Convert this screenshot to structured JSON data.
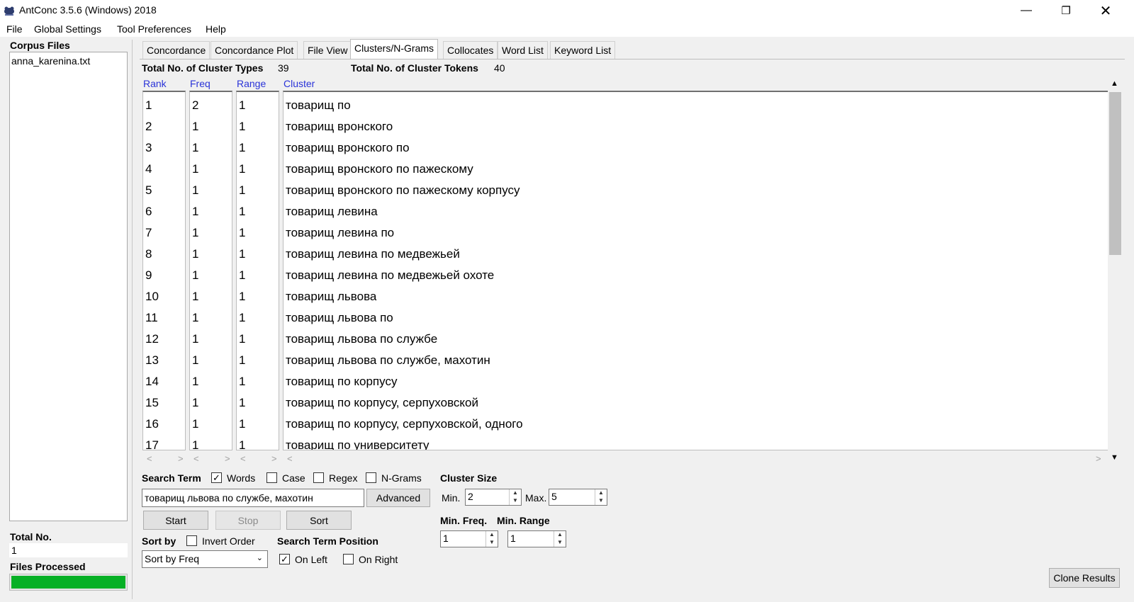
{
  "window": {
    "title": "AntConc 3.5.6 (Windows) 2018"
  },
  "menu": [
    "File",
    "Global Settings",
    "Tool Preferences",
    "Help"
  ],
  "left_panel": {
    "corpus_files_label": "Corpus Files",
    "files": [
      "anna_karenina.txt"
    ],
    "total_no_label": "Total No.",
    "total_no_value": "1",
    "files_processed_label": "Files Processed",
    "progress": 1.0
  },
  "tabs": [
    "Concordance",
    "Concordance Plot",
    "File View",
    "Clusters/N-Grams",
    "Collocates",
    "Word List",
    "Keyword List"
  ],
  "active_tab": "Clusters/N-Grams",
  "stats": {
    "types_label": "Total No. of Cluster Types",
    "types_value": "39",
    "tokens_label": "Total No. of Cluster Tokens",
    "tokens_value": "40"
  },
  "columns": {
    "rank": "Rank",
    "freq": "Freq",
    "range": "Range",
    "cluster": "Cluster"
  },
  "rows": [
    {
      "rank": "1",
      "freq": "2",
      "range": "1",
      "cluster": "товарищ по"
    },
    {
      "rank": "2",
      "freq": "1",
      "range": "1",
      "cluster": "товарищ вронского"
    },
    {
      "rank": "3",
      "freq": "1",
      "range": "1",
      "cluster": "товарищ вронского по"
    },
    {
      "rank": "4",
      "freq": "1",
      "range": "1",
      "cluster": "товарищ вронского по пажескому"
    },
    {
      "rank": "5",
      "freq": "1",
      "range": "1",
      "cluster": "товарищ вронского по пажескому корпусу"
    },
    {
      "rank": "6",
      "freq": "1",
      "range": "1",
      "cluster": "товарищ левина"
    },
    {
      "rank": "7",
      "freq": "1",
      "range": "1",
      "cluster": "товарищ левина по"
    },
    {
      "rank": "8",
      "freq": "1",
      "range": "1",
      "cluster": "товарищ левина по медвежьей"
    },
    {
      "rank": "9",
      "freq": "1",
      "range": "1",
      "cluster": "товарищ левина по медвежьей охоте"
    },
    {
      "rank": "10",
      "freq": "1",
      "range": "1",
      "cluster": "товарищ львова"
    },
    {
      "rank": "11",
      "freq": "1",
      "range": "1",
      "cluster": "товарищ львова по"
    },
    {
      "rank": "12",
      "freq": "1",
      "range": "1",
      "cluster": "товарищ львова по службе"
    },
    {
      "rank": "13",
      "freq": "1",
      "range": "1",
      "cluster": "товарищ львова по службе, махотин"
    },
    {
      "rank": "14",
      "freq": "1",
      "range": "1",
      "cluster": "товарищ по корпусу"
    },
    {
      "rank": "15",
      "freq": "1",
      "range": "1",
      "cluster": "товарищ по корпусу, серпуховской"
    },
    {
      "rank": "16",
      "freq": "1",
      "range": "1",
      "cluster": "товарищ по корпусу, серпуховской, одного"
    },
    {
      "rank": "17",
      "freq": "1",
      "range": "1",
      "cluster": "товарищ по университету"
    }
  ],
  "controls": {
    "search_term_label": "Search Term",
    "words_label": "Words",
    "words_checked": true,
    "case_label": "Case",
    "case_checked": false,
    "regex_label": "Regex",
    "regex_checked": false,
    "ngrams_label": "N-Grams",
    "ngrams_checked": false,
    "search_value": "товарищ львова по службе, махотин",
    "advanced_label": "Advanced",
    "start_label": "Start",
    "stop_label": "Stop",
    "sort_label": "Sort",
    "sort_by_label": "Sort by",
    "invert_order_label": "Invert Order",
    "invert_order_checked": false,
    "sort_select_value": "Sort by Freq",
    "search_term_position_label": "Search Term Position",
    "on_left_label": "On Left",
    "on_left_checked": true,
    "on_right_label": "On Right",
    "on_right_checked": false,
    "cluster_size_label": "Cluster Size",
    "min_label": "Min.",
    "min_value": "2",
    "max_label": "Max.",
    "max_value": "5",
    "min_freq_label": "Min. Freq.",
    "min_freq_value": "1",
    "min_range_label": "Min. Range",
    "min_range_value": "1",
    "clone_results_label": "Clone Results"
  },
  "colors": {
    "header_blue": "#2a33d8",
    "progress_green": "#06b025"
  }
}
